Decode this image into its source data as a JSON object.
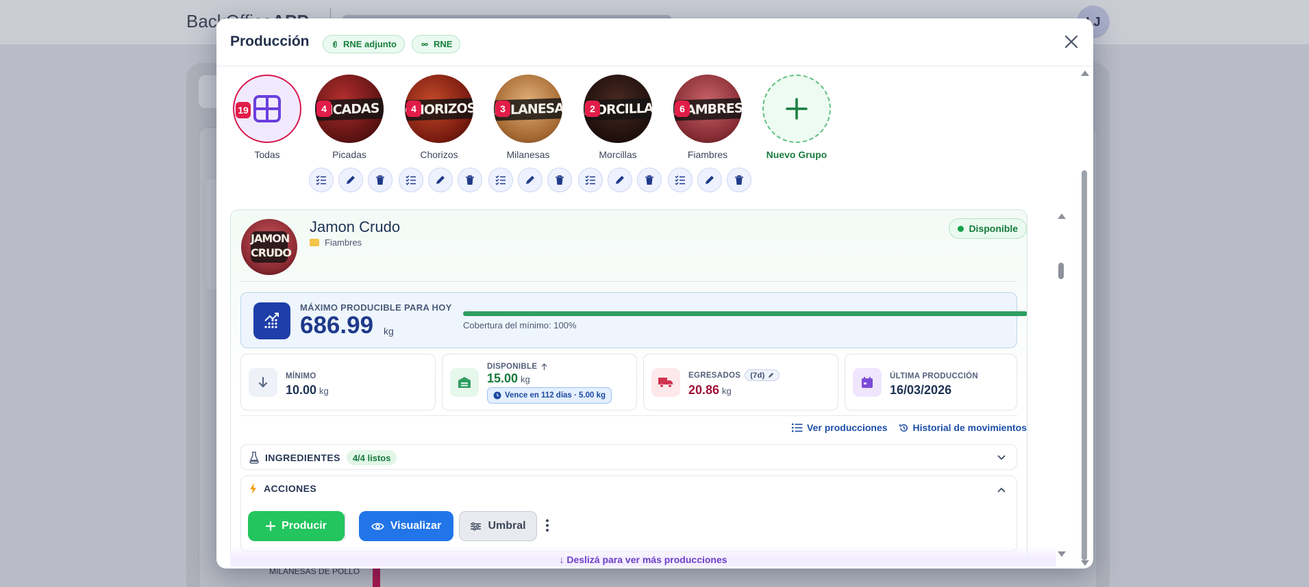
{
  "background": {
    "brand_light": "BackOffice",
    "brand_bold": "APP",
    "avatar_initials": "LJ",
    "chart_row_label": "MILANESAS DE POLLO"
  },
  "modal": {
    "title": "Producción",
    "pills": [
      {
        "label": "RNE adjunto",
        "icon": "paperclip-icon"
      },
      {
        "label": "RNE",
        "icon": "infinity-icon"
      }
    ],
    "close_icon": "close-icon"
  },
  "groups": [
    {
      "label": "Todas",
      "count": "19",
      "icon": "grid-icon"
    },
    {
      "label": "Picadas",
      "count": "4",
      "photo_text": "PICADAS"
    },
    {
      "label": "Chorizos",
      "count": "4",
      "photo_text": "CHORIZOS"
    },
    {
      "label": "Milanesas",
      "count": "3",
      "photo_text": "MILANESAS"
    },
    {
      "label": "Morcillas",
      "count": "2",
      "photo_text": "MORCILLAS"
    },
    {
      "label": "Fiambres",
      "count": "6",
      "photo_text": "FIAMBRES"
    },
    {
      "label": "Nuevo Grupo",
      "icon": "plus-icon"
    }
  ],
  "group_actions": [
    "checklist-icon",
    "pencil-icon",
    "trash-icon"
  ],
  "product": {
    "name": "Jamon Crudo",
    "photo_text_1": "JAMON",
    "photo_text_2": "CRUDO",
    "category": "Fiambres",
    "status": "Disponible",
    "max_label": "MÁXIMO PRODUCIBLE PARA HOY",
    "max_value": "686.99",
    "max_unit": "kg",
    "coverage_label": "Cobertura del mínimo: 100%",
    "coverage_fraction": 1.0,
    "stats": {
      "minimo": {
        "label": "MÍNIMO",
        "value": "10.00",
        "unit": "kg"
      },
      "disponible": {
        "label": "DISPONIBLE",
        "value": "15.00",
        "unit": "kg",
        "expiry": "Vence en 112 días · 5.00 kg"
      },
      "egresados": {
        "label": "EGRESADOS",
        "tag": "(7d)",
        "value": "20.86",
        "unit": "kg"
      },
      "ultima": {
        "label": "ÚLTIMA PRODUCCIÓN",
        "value": "16/03/2026"
      }
    },
    "links": {
      "ver": "Ver producciones",
      "historial": "Historial de movimientos"
    },
    "ingredientes": {
      "label": "INGREDIENTES",
      "count": "4/4 listos"
    },
    "acciones": {
      "label": "ACCIONES",
      "producir": "Producir",
      "visualizar": "Visualizar",
      "umbral": "Umbral"
    }
  },
  "scroll_hint": "↓ Deslizá para ver más producciones",
  "colors": {
    "accent_blue": "#1e3fa8",
    "success_green": "#22c55e",
    "badge_red": "#e11d48",
    "egresados_red": "#9f1239"
  }
}
